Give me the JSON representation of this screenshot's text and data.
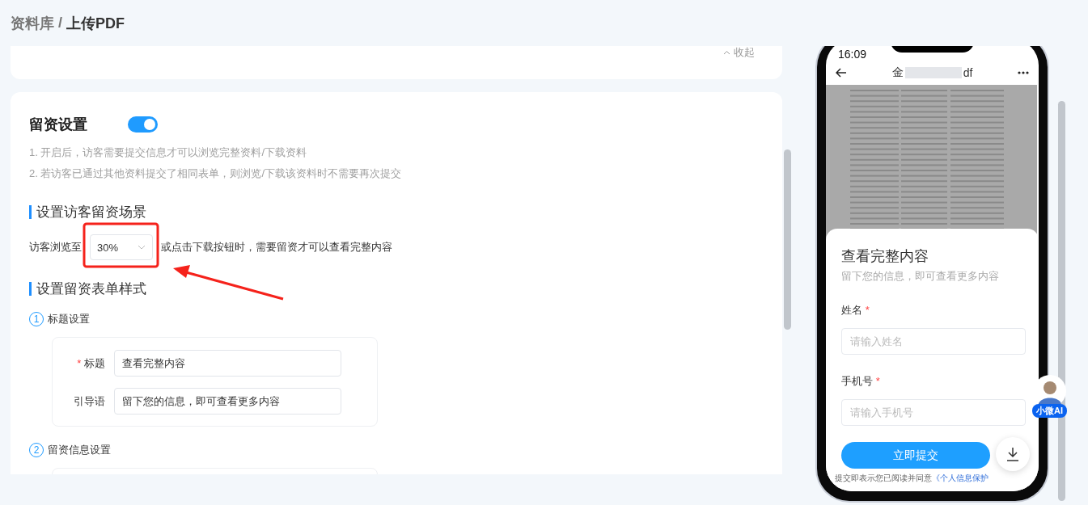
{
  "breadcrumb": {
    "parent": "资料库",
    "separator": "/",
    "current": "上传PDF"
  },
  "collapse_link": "收起",
  "lead_settings": {
    "title": "留资设置",
    "enabled": true,
    "notes": [
      "1. 开启后，访客需要提交信息才可以浏览完整资料/下载资料",
      "2. 若访客已通过其他资料提交了相同表单，则浏览/下载该资料时不需要再次提交"
    ],
    "scene": {
      "heading": "设置访客留资场景",
      "prefix": "访客浏览至",
      "select_value": "30%",
      "suffix": "或点击下载按钮时，需要留资才可以查看完整内容"
    },
    "required_mark": "*",
    "form_style": {
      "heading": "设置留资表单样式",
      "steps": [
        {
          "number": "1",
          "label": "标题设置",
          "fields": [
            {
              "label": "标题",
              "required": true,
              "value": "查看完整内容"
            },
            {
              "label": "引导语",
              "required": false,
              "value": "留下您的信息，即可查看更多内容"
            }
          ]
        },
        {
          "number": "2",
          "label": "留资信息设置"
        }
      ]
    }
  },
  "phone": {
    "time": "16:09",
    "title_start": "金",
    "title_end": "df",
    "sheet": {
      "title": "查看完整内容",
      "required_mark": "*",
      "subtitle": "留下您的信息，即可查看更多内容",
      "fields": [
        {
          "label": "姓名",
          "required": true,
          "placeholder": "请输入姓名"
        },
        {
          "label": "手机号",
          "required": true,
          "placeholder": "请输入手机号"
        }
      ],
      "submit": "立即提交",
      "agreement": "提交即表示您已阅读并同意",
      "agreement_link": "《个人信息保护"
    }
  },
  "assistant": {
    "label": "小微AI"
  }
}
